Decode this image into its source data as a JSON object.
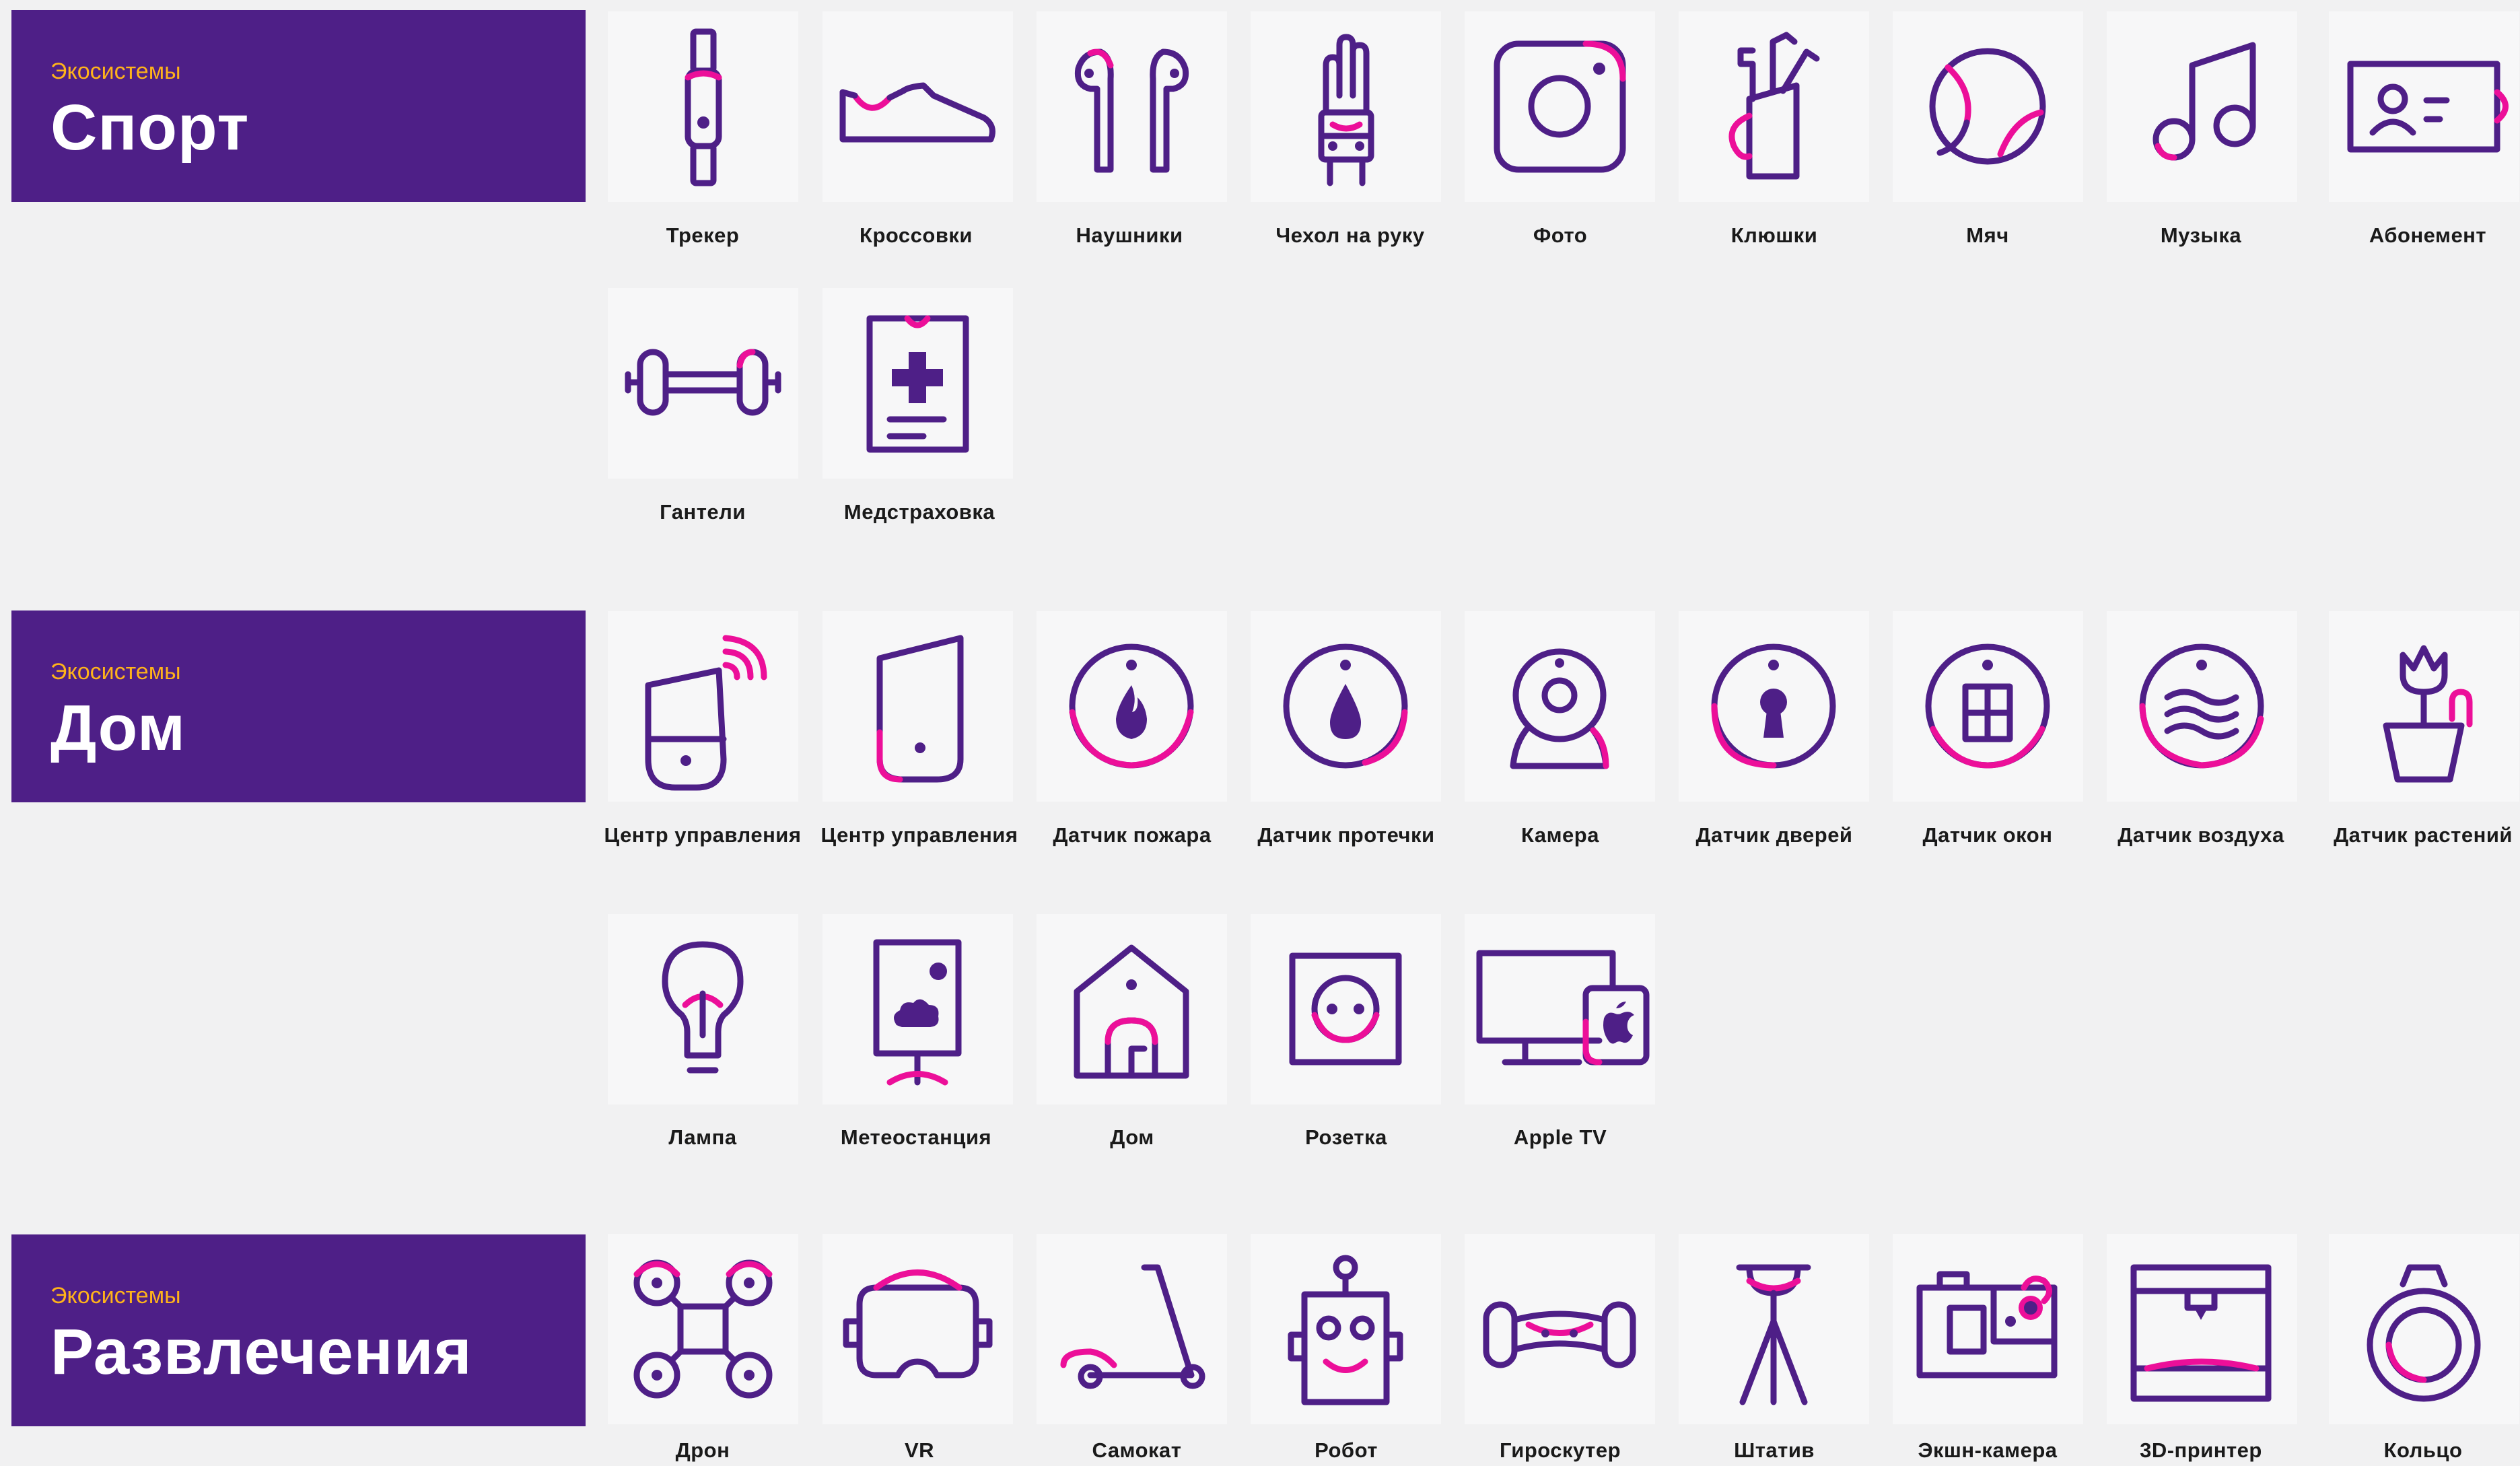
{
  "colors": {
    "brand": "#4e1f87",
    "accent": "#ec0f99",
    "subtitle": "#ffb31a",
    "tile": "#f7f7f8",
    "background": "#f1f1f2"
  },
  "sections": [
    {
      "subtitle": "Экосистемы",
      "title": "Спорт",
      "items": [
        {
          "icon": "tracker-icon",
          "label": "Трекер"
        },
        {
          "icon": "sneakers-icon",
          "label": "Кроссовки"
        },
        {
          "icon": "earphones-icon",
          "label": "Наушники"
        },
        {
          "icon": "arm-case-icon",
          "label": "Чехол на руку"
        },
        {
          "icon": "camera-photo-icon",
          "label": "Фото"
        },
        {
          "icon": "golf-clubs-icon",
          "label": "Клюшки"
        },
        {
          "icon": "ball-icon",
          "label": "Мяч"
        },
        {
          "icon": "music-note-icon",
          "label": "Музыка"
        },
        {
          "icon": "membership-card-icon",
          "label": "Абонемент"
        },
        {
          "icon": "dumbbell-icon",
          "label": "Гантели"
        },
        {
          "icon": "medical-insurance-icon",
          "label": "Медстраховка"
        }
      ]
    },
    {
      "subtitle": "Экосистемы",
      "title": "Дом",
      "items": [
        {
          "icon": "smart-hub-wireless-icon",
          "label": "Центр управления"
        },
        {
          "icon": "smart-hub-icon",
          "label": "Центр управления"
        },
        {
          "icon": "fire-sensor-icon",
          "label": "Датчик пожара"
        },
        {
          "icon": "leak-sensor-icon",
          "label": "Датчик протечки"
        },
        {
          "icon": "webcam-icon",
          "label": "Камера"
        },
        {
          "icon": "door-sensor-icon",
          "label": "Датчик дверей"
        },
        {
          "icon": "window-sensor-icon",
          "label": "Датчик окон"
        },
        {
          "icon": "air-sensor-icon",
          "label": "Датчик воздуха"
        },
        {
          "icon": "plant-sensor-icon",
          "label": "Датчик растений"
        },
        {
          "icon": "lamp-icon",
          "label": "Лампа"
        },
        {
          "icon": "weather-station-icon",
          "label": "Метеостанция"
        },
        {
          "icon": "house-icon",
          "label": "Дом"
        },
        {
          "icon": "power-socket-icon",
          "label": "Розетка"
        },
        {
          "icon": "apple-tv-icon",
          "label": "Apple TV"
        }
      ]
    },
    {
      "subtitle": "Экосистемы",
      "title": "Развлечения",
      "items": [
        {
          "icon": "drone-icon",
          "label": "Дрон"
        },
        {
          "icon": "vr-headset-icon",
          "label": "VR"
        },
        {
          "icon": "scooter-icon",
          "label": "Самокат"
        },
        {
          "icon": "robot-icon",
          "label": "Робот"
        },
        {
          "icon": "gyroscooter-icon",
          "label": "Гироскутер"
        },
        {
          "icon": "tripod-icon",
          "label": "Штатив"
        },
        {
          "icon": "action-camera-icon",
          "label": "Экшн-камера"
        },
        {
          "icon": "3d-printer-icon",
          "label": "3D-принтер"
        },
        {
          "icon": "ring-icon",
          "label": "Кольцо"
        }
      ]
    }
  ]
}
